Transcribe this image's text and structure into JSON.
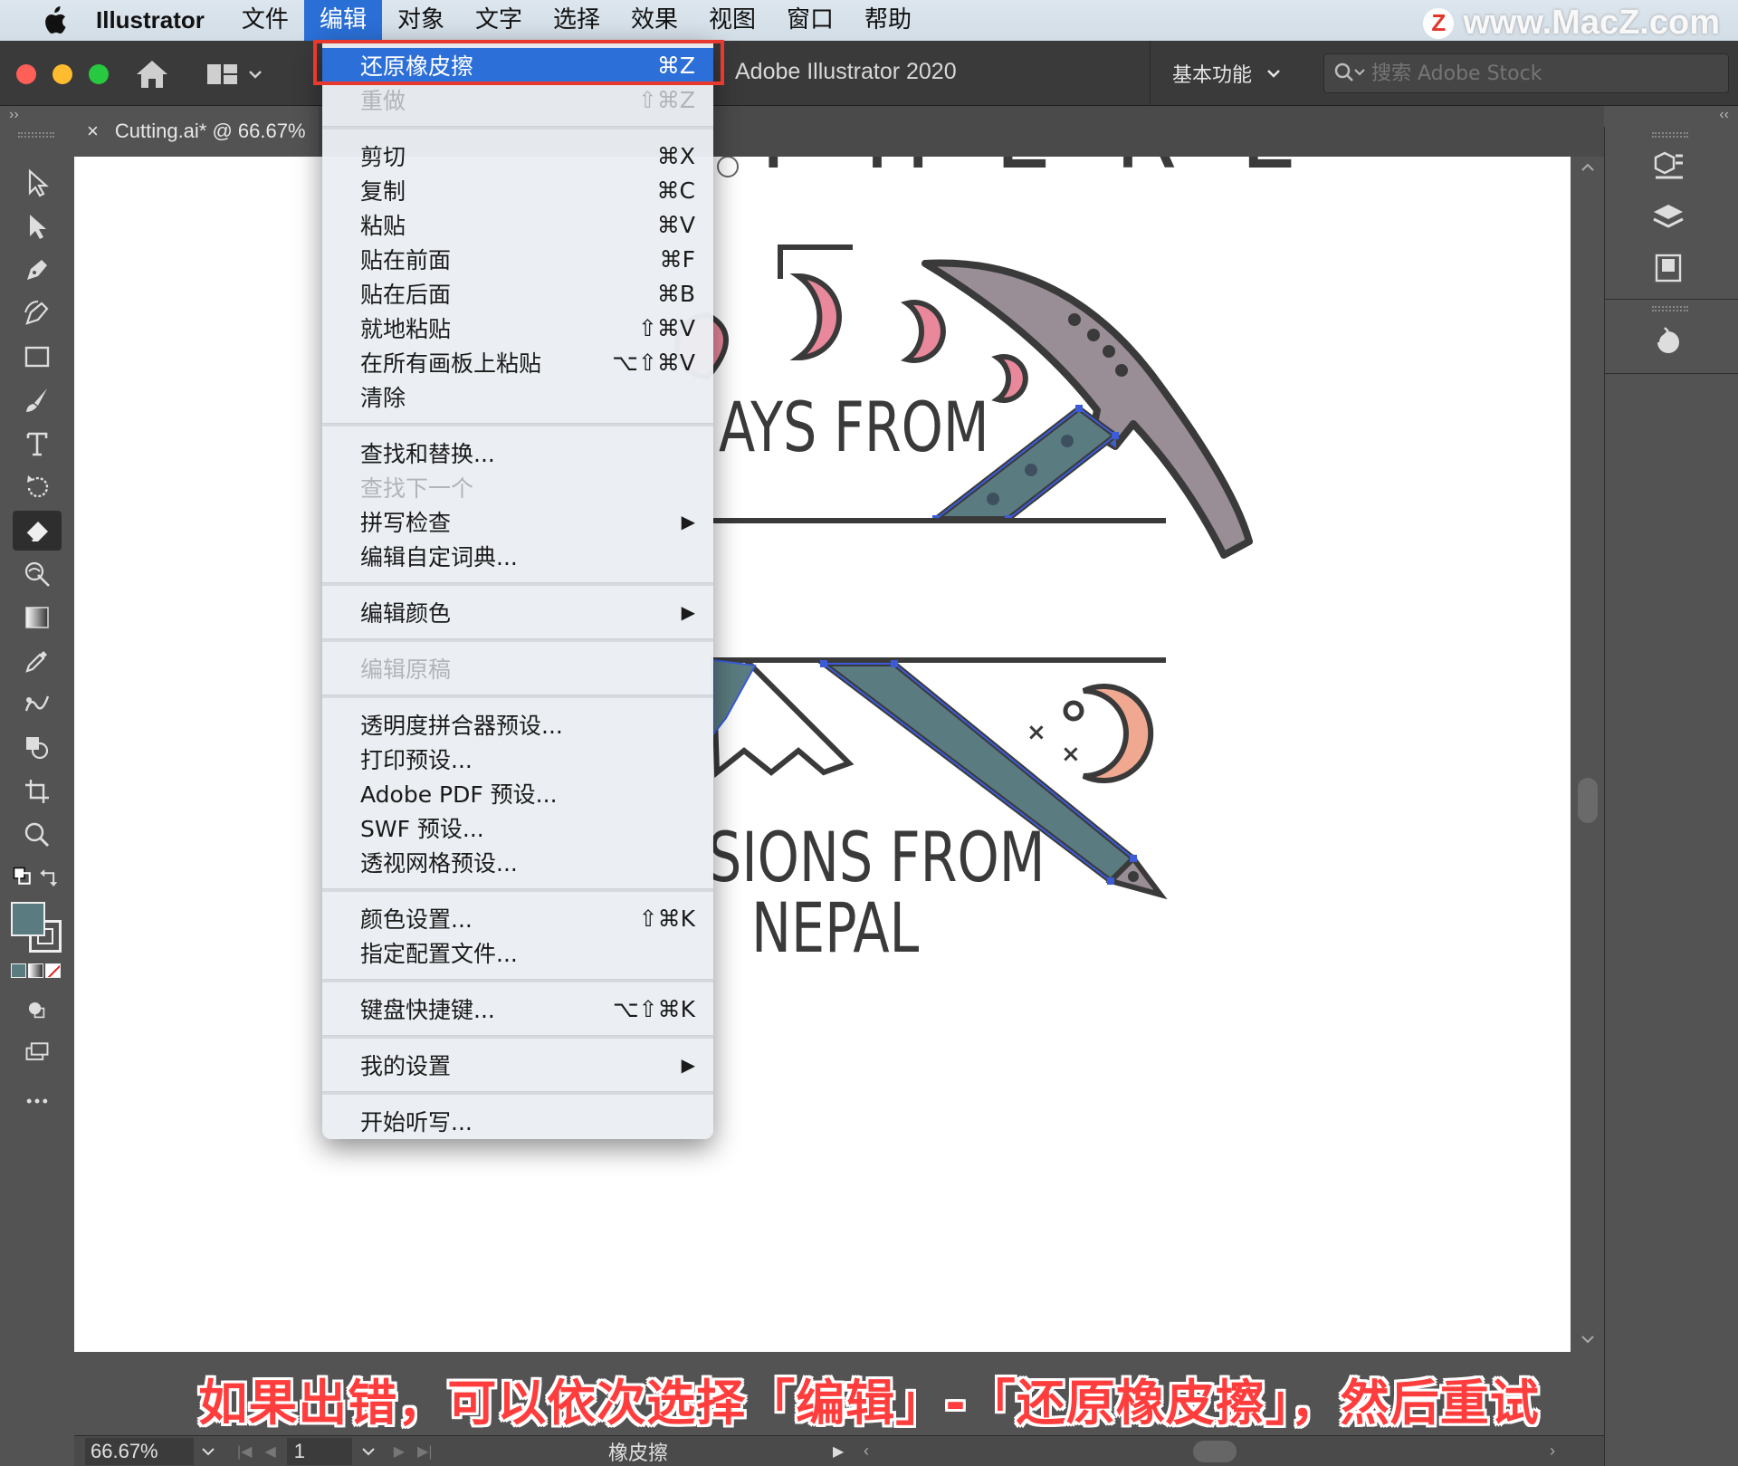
{
  "menubar": {
    "app_name": "Illustrator",
    "items": [
      "文件",
      "编辑",
      "对象",
      "文字",
      "选择",
      "效果",
      "视图",
      "窗口",
      "帮助"
    ],
    "active_index": 1
  },
  "watermark": {
    "logo": "Z",
    "text": "www.MacZ.com"
  },
  "titlebar": {
    "app_title": "Adobe Illustrator 2020",
    "workspace": "基本功能",
    "search_placeholder": "搜索 Adobe Stock"
  },
  "tab": {
    "close": "×",
    "label": "Cutting.ai* @ 66.67%"
  },
  "edit_menu": {
    "items": [
      {
        "type": "item",
        "label": "还原橡皮擦",
        "shortcut": "⌘Z",
        "highlighted": true
      },
      {
        "type": "item",
        "label": "重做",
        "shortcut": "⇧⌘Z",
        "disabled": true
      },
      {
        "type": "sep"
      },
      {
        "type": "item",
        "label": "剪切",
        "shortcut": "⌘X"
      },
      {
        "type": "item",
        "label": "复制",
        "shortcut": "⌘C"
      },
      {
        "type": "item",
        "label": "粘贴",
        "shortcut": "⌘V"
      },
      {
        "type": "item",
        "label": "贴在前面",
        "shortcut": "⌘F"
      },
      {
        "type": "item",
        "label": "贴在后面",
        "shortcut": "⌘B"
      },
      {
        "type": "item",
        "label": "就地粘贴",
        "shortcut": "⇧⌘V"
      },
      {
        "type": "item",
        "label": "在所有画板上粘贴",
        "shortcut": "⌥⇧⌘V"
      },
      {
        "type": "item",
        "label": "清除",
        "shortcut": ""
      },
      {
        "type": "sep"
      },
      {
        "type": "item",
        "label": "查找和替换...",
        "shortcut": ""
      },
      {
        "type": "item",
        "label": "查找下一个",
        "shortcut": "",
        "disabled": true
      },
      {
        "type": "item",
        "label": "拼写检查",
        "shortcut": "▶",
        "submenu": true
      },
      {
        "type": "item",
        "label": "编辑自定词典...",
        "shortcut": ""
      },
      {
        "type": "sep"
      },
      {
        "type": "item",
        "label": "编辑颜色",
        "shortcut": "▶",
        "submenu": true
      },
      {
        "type": "sep"
      },
      {
        "type": "item",
        "label": "编辑原稿",
        "shortcut": "",
        "disabled": true
      },
      {
        "type": "sep"
      },
      {
        "type": "item",
        "label": "透明度拼合器预设...",
        "shortcut": ""
      },
      {
        "type": "item",
        "label": "打印预设...",
        "shortcut": ""
      },
      {
        "type": "item",
        "label": "Adobe PDF 预设...",
        "shortcut": ""
      },
      {
        "type": "item",
        "label": "SWF 预设...",
        "shortcut": ""
      },
      {
        "type": "item",
        "label": "透视网格预设...",
        "shortcut": ""
      },
      {
        "type": "sep"
      },
      {
        "type": "item",
        "label": "颜色设置...",
        "shortcut": "⇧⌘K"
      },
      {
        "type": "item",
        "label": "指定配置文件...",
        "shortcut": ""
      },
      {
        "type": "sep"
      },
      {
        "type": "item",
        "label": "键盘快捷键...",
        "shortcut": "⌥⇧⌘K"
      },
      {
        "type": "sep"
      },
      {
        "type": "item",
        "label": "我的设置",
        "shortcut": "▶",
        "submenu": true
      },
      {
        "type": "sep"
      },
      {
        "type": "item",
        "label": "开始听写...",
        "shortcut": ""
      }
    ]
  },
  "artwork": {
    "top_text": "THERE",
    "days_text": "AYS FROM",
    "sions_text": "SIONS FROM",
    "nepal_text": "NEPAL",
    "colors": {
      "pink": "#e8889a",
      "teal": "#5a7c80",
      "grey_pick": "#9a8e96",
      "outline": "#3a3a3a",
      "peach": "#f0a890",
      "selection": "#3b5bd9"
    }
  },
  "statusbar": {
    "zoom": "66.67%",
    "artboard": "1",
    "tool": "橡皮擦"
  },
  "subtitle": "如果出错，可以依次选择「编辑」-「还原橡皮擦」，然后重试",
  "colors": {
    "highlight": "#2d6fd8",
    "callout": "#e8392f",
    "subtitle": "#ff3d3d"
  }
}
